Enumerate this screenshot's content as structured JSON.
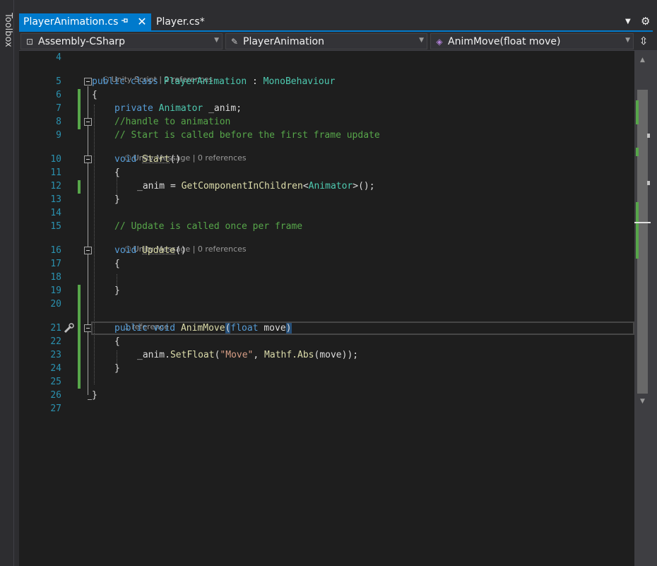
{
  "toolbox": {
    "label": "Toolbox"
  },
  "tabs": [
    {
      "label": "PlayerAnimation.cs",
      "active": true,
      "pinned": true
    },
    {
      "label": "Player.cs*",
      "active": false
    }
  ],
  "tab_icons": {
    "pin": "pin-icon",
    "close": "close-icon",
    "dropdown": "chevron-down-icon",
    "settings": "gear-icon"
  },
  "navbar": {
    "project": "Assembly-CSharp",
    "type": "PlayerAnimation",
    "member": "AnimMove(float move)",
    "split_icon": "split-icon"
  },
  "colors": {
    "accent": "#007acc",
    "keyword": "#569cd6",
    "type": "#4ec9b0",
    "comment": "#57a64a",
    "string": "#d69d85",
    "method": "#dcdcaa",
    "line_number": "#2b91af",
    "editor_bg": "#1e1e1e"
  },
  "codelens": {
    "class": "Unity Script | 2 references",
    "start": "Unity Message | 0 references",
    "update": "Unity Message | 0 references",
    "animmove": "1 reference"
  },
  "lines": [
    {
      "n": "4",
      "text": ""
    },
    {
      "n": "5",
      "text": "public class PlayerAnimation : MonoBehaviour"
    },
    {
      "n": "6",
      "text": "{"
    },
    {
      "n": "7",
      "text": "    private Animator _anim;"
    },
    {
      "n": "8",
      "text": "    //handle to animation"
    },
    {
      "n": "9",
      "text": "    // Start is called before the first frame update"
    },
    {
      "n": "10",
      "text": "    void Start()"
    },
    {
      "n": "11",
      "text": "    {"
    },
    {
      "n": "12",
      "text": "        _anim = GetComponentInChildren<Animator>();"
    },
    {
      "n": "13",
      "text": "    }"
    },
    {
      "n": "14",
      "text": ""
    },
    {
      "n": "15",
      "text": "    // Update is called once per frame"
    },
    {
      "n": "16",
      "text": "    void Update()"
    },
    {
      "n": "17",
      "text": "    {"
    },
    {
      "n": "18",
      "text": ""
    },
    {
      "n": "19",
      "text": "    }"
    },
    {
      "n": "20",
      "text": ""
    },
    {
      "n": "21",
      "text": "    public void AnimMove(float move)"
    },
    {
      "n": "22",
      "text": "    {"
    },
    {
      "n": "23",
      "text": "        _anim.SetFloat(\"Move\", Mathf.Abs(move));"
    },
    {
      "n": "24",
      "text": "    }"
    },
    {
      "n": "25",
      "text": ""
    },
    {
      "n": "26",
      "text": "}"
    },
    {
      "n": "27",
      "text": ""
    }
  ],
  "tokens": {
    "public": "public",
    "class": "class",
    "private": "private",
    "void": "void",
    "float": "float",
    "PlayerAnimation": "PlayerAnimation",
    "colon": " : ",
    "MonoBehaviour": "MonoBehaviour",
    "open_brace": "{",
    "close_brace": "}",
    "Animator": "Animator",
    "_anim_decl": " _anim;",
    "comment1": "//handle to animation",
    "comment2": "// Start is called before the first frame update",
    "Start": "Start",
    "parens": "()",
    "_anim_assign": "_anim = ",
    "GetComponentInChildren": "GetComponentInChildren",
    "lt": "<",
    "gt_call": ">();",
    "comment3": "// Update is called once per frame",
    "Update": "Update",
    "AnimMove": "AnimMove",
    "lparen": "(",
    "move": "move",
    "rparen": ")",
    "_anim_dot": "_anim.",
    "SetFloat": "SetFloat",
    "str_move": "\"Move\"",
    "comma": ", ",
    "Mathf_dot": "Mathf.",
    "Abs": "Abs",
    "call_end": "));",
    "space": " "
  }
}
